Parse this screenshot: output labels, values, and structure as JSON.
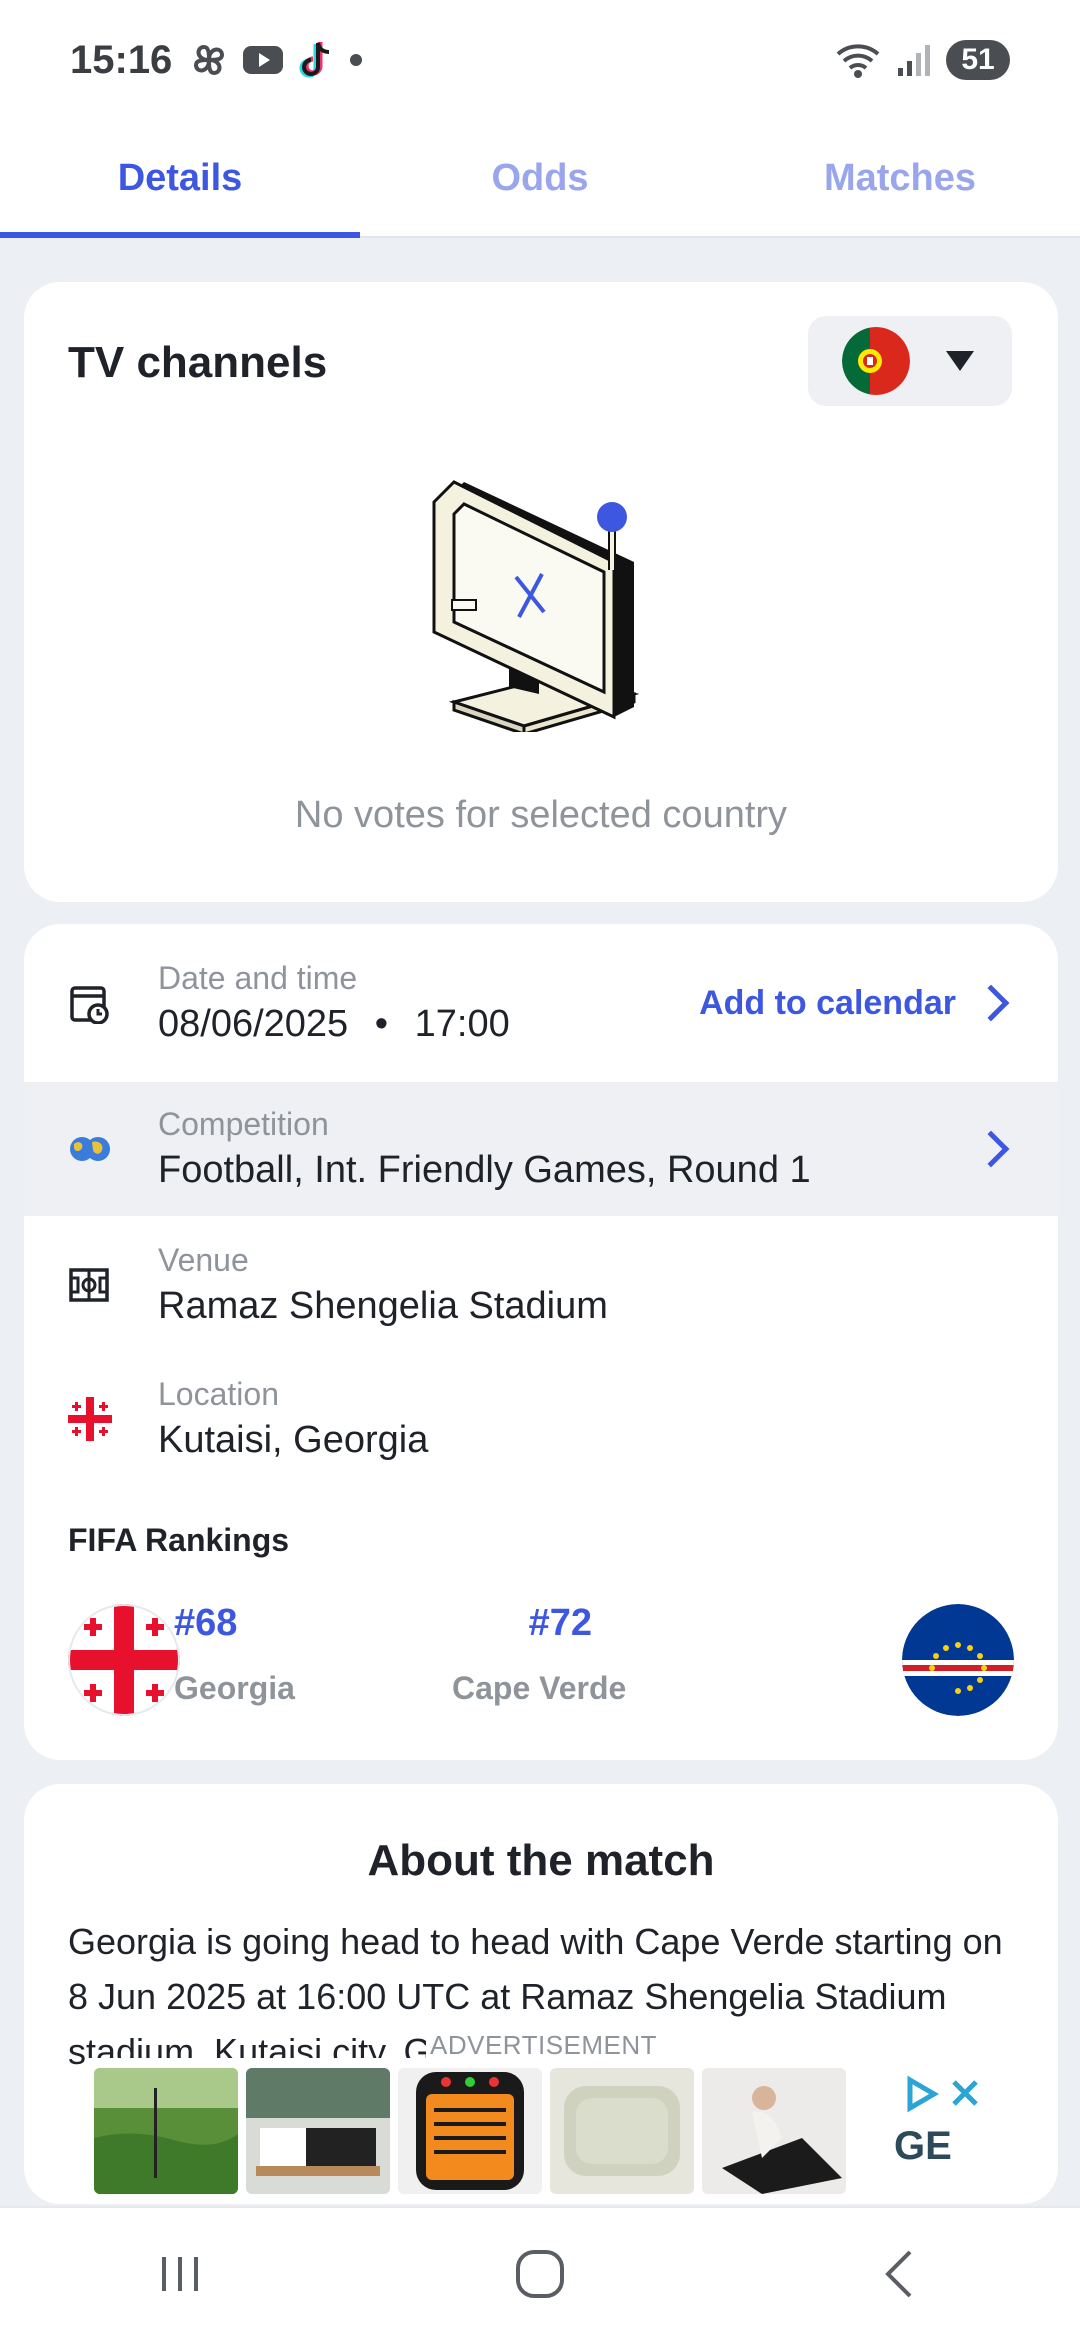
{
  "status_bar": {
    "time": "15:16",
    "icons": [
      "pinwheel-icon",
      "youtube-icon",
      "tiktok-icon",
      "dot-icon"
    ],
    "right_icons": [
      "wifi-icon",
      "signal-icon"
    ],
    "battery": "51"
  },
  "tabs": [
    {
      "label": "Details",
      "active": true
    },
    {
      "label": "Odds",
      "active": false
    },
    {
      "label": "Matches",
      "active": false
    }
  ],
  "tv": {
    "title": "TV channels",
    "country_flag": "portugal-flag",
    "empty_text": "No votes for selected country"
  },
  "info": {
    "date": {
      "label": "Date and time",
      "date": "08/06/2025",
      "separator": "•",
      "time": "17:00",
      "action": "Add to calendar"
    },
    "competition": {
      "label": "Competition",
      "value": "Football, Int. Friendly Games, Round 1"
    },
    "venue": {
      "label": "Venue",
      "value": "Ramaz Shengelia Stadium"
    },
    "location": {
      "label": "Location",
      "value": "Kutaisi, Georgia"
    }
  },
  "fifa": {
    "title": "FIFA Rankings",
    "home": {
      "rank": "#68",
      "name": "Georgia"
    },
    "away": {
      "rank": "#72",
      "name": "Cape Verde"
    }
  },
  "about": {
    "title": "About the match",
    "text": "Georgia is going head to head with Cape Verde starting on 8 Jun 2025 at 16:00 UTC at Ramaz Shengelia Stadium stadium, Kutaisi city, Georgia. T"
  },
  "ad": {
    "label": "ADVERTISEMENT",
    "brand": "GE"
  },
  "colors": {
    "accent": "#3e57e0",
    "muted": "#8f949b",
    "background": "#eceff4"
  }
}
